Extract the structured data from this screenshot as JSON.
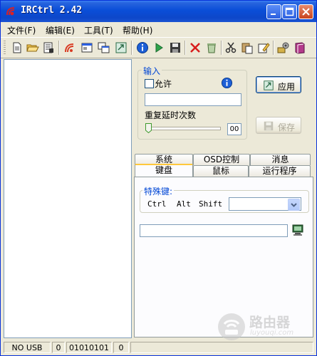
{
  "window": {
    "title": "IRCtrl 2.42"
  },
  "menu": {
    "items": [
      "文件(F)",
      "编辑(E)",
      "工具(T)",
      "帮助(H)"
    ]
  },
  "toolbar": {
    "icons": [
      "new-file-icon",
      "open-folder-icon",
      "save-list-icon",
      "signal-icon",
      "window-icon",
      "copy-window-icon",
      "import-icon",
      "info-icon",
      "play-icon",
      "save-icon",
      "delete-icon",
      "recycle-icon",
      "cut-icon",
      "paste-icon",
      "edit-icon",
      "settings-icon",
      "book-icon"
    ]
  },
  "input_group": {
    "label": "输入",
    "allow_label": "允许",
    "allow_checked": false,
    "text_value": "",
    "repeat_label": "重复延时次数",
    "repeat_value": "00",
    "slider_level": 0
  },
  "buttons": {
    "apply": "应用",
    "save": "保存"
  },
  "tabs": {
    "row1": [
      "系统",
      "OSD控制",
      "消息"
    ],
    "row2": [
      "键盘",
      "鼠标",
      "运行程序"
    ],
    "active": "键盘"
  },
  "keyboard": {
    "special_keys_label": "特殊键:",
    "ctrl": "Ctrl",
    "alt": "Alt",
    "shift": "Shift",
    "combo_value": "",
    "key_value": ""
  },
  "status": [
    "NO USB",
    "0",
    "01010101",
    "0"
  ],
  "watermark": {
    "main": "路由器",
    "sub": "luyouqi.com"
  },
  "colors": {
    "titlebar": "#0a4ed8",
    "accent": "#0046d5",
    "tab_highlight": "#ffc83c"
  }
}
